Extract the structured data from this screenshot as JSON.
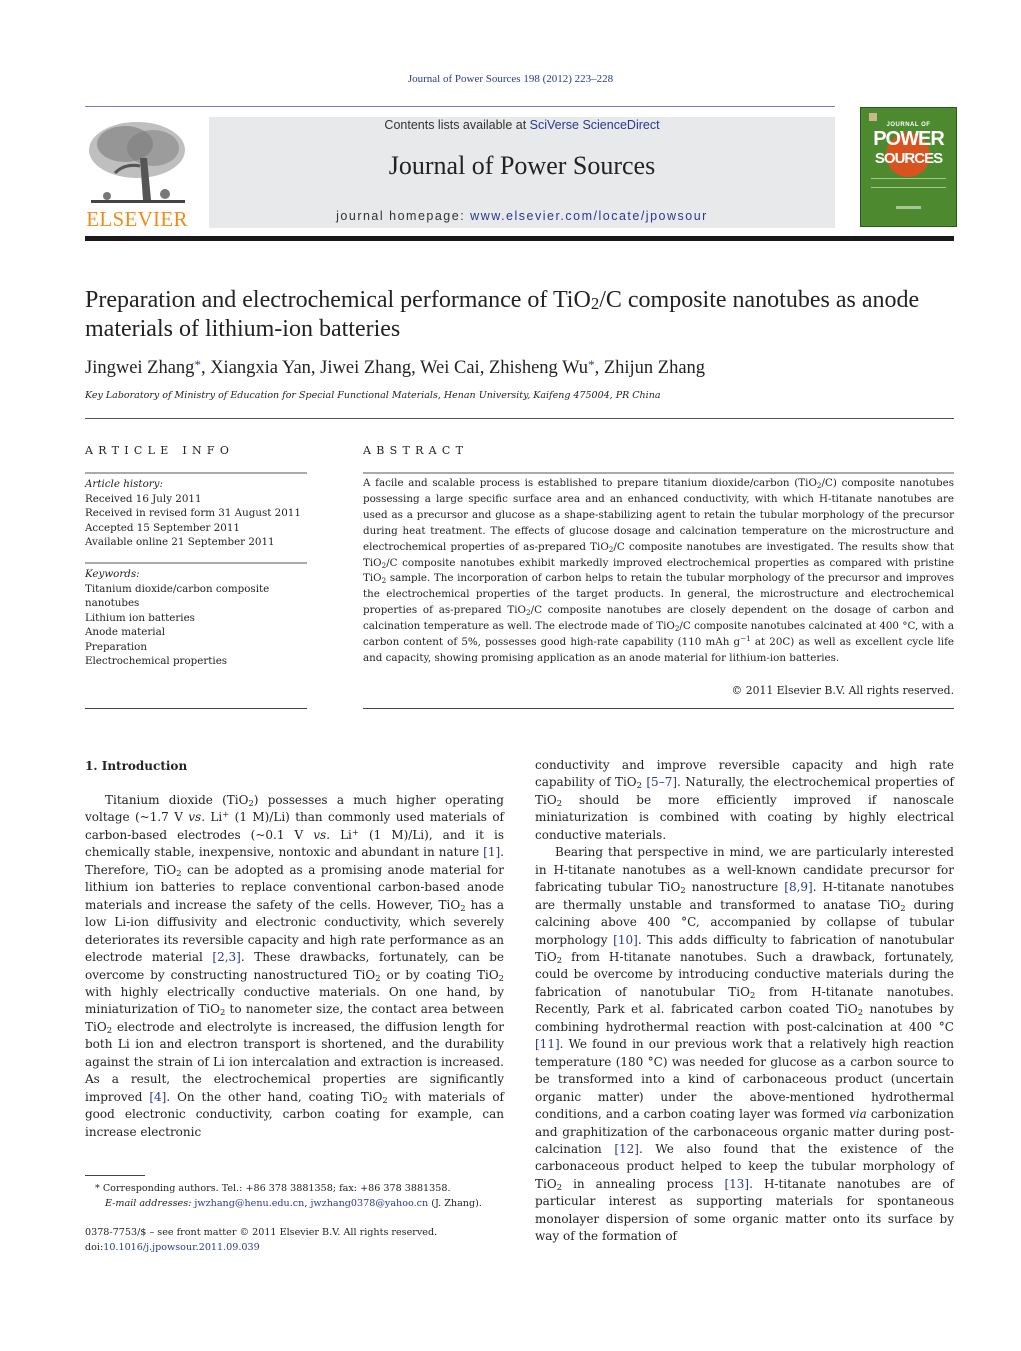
{
  "running_head": "Journal of Power Sources 198 (2012) 223–228",
  "masthead": {
    "publisher_logo_text": "ELSEVIER",
    "contents_prefix": "Contents lists available at ",
    "contents_link": "SciVerse ScienceDirect",
    "journal_name": "Journal of Power Sources",
    "homepage_prefix": "journal homepage: ",
    "homepage_link": "www.elsevier.com/locate/jpowsour",
    "cover": {
      "line1": "JOURNAL OF",
      "line2": "POWER",
      "line3": "SOURCES",
      "colors": {
        "background": "#4d8a2f",
        "circle": "#d9531e"
      }
    }
  },
  "article": {
    "title_part1": "Preparation and electrochemical performance of TiO",
    "title_sub": "2",
    "title_part2": "/C composite nanotubes as anode materials of lithium-ion batteries",
    "authors": [
      {
        "name": "Jingwei Zhang",
        "corresponding": true
      },
      {
        "name": "Xiangxia Yan",
        "corresponding": false
      },
      {
        "name": "Jiwei Zhang",
        "corresponding": false
      },
      {
        "name": "Wei Cai",
        "corresponding": false
      },
      {
        "name": "Zhisheng Wu",
        "corresponding": true
      },
      {
        "name": "Zhijun Zhang",
        "corresponding": false
      }
    ],
    "author_sep": ", ",
    "star": "*",
    "affiliation": "Key Laboratory of Ministry of Education for Special Functional Materials, Henan University, Kaifeng 475004, PR China"
  },
  "article_info": {
    "heading": "ARTICLE INFO",
    "history_label": "Article history:",
    "history": [
      "Received 16 July 2011",
      "Received in revised form 31 August 2011",
      "Accepted 15 September 2011",
      "Available online 21 September 2011"
    ],
    "keywords_label": "Keywords:",
    "keywords": [
      "Titanium dioxide/carbon composite nanotubes",
      "Lithium ion batteries",
      "Anode material",
      "Preparation",
      "Electrochemical properties"
    ]
  },
  "abstract": {
    "heading": "ABSTRACT",
    "segments": [
      "A facile and scalable process is established to prepare titanium dioxide/carbon (TiO",
      "2",
      "/C) composite nanotubes possessing a large specific surface area and an enhanced conductivity, with which H-titanate nanotubes are used as a precursor and glucose as a shape-stabilizing agent to retain the tubular morphology of the precursor during heat treatment. The effects of glucose dosage and calcination temperature on the microstructure and electrochemical properties of as-prepared TiO",
      "2",
      "/C composite nanotubes are investigated. The results show that TiO",
      "2",
      "/C composite nanotubes exhibit markedly improved electrochemical properties as compared with pristine TiO",
      "2",
      " sample. The incorporation of carbon helps to retain the tubular morphology of the precursor and improves the electrochemical properties of the target products. In general, the microstructure and electrochemical properties of as-prepared TiO",
      "2",
      "/C composite nanotubes are closely dependent on the dosage of carbon and calcination temperature as well. The electrode made of TiO",
      "2",
      "/C composite nanotubes calcinated at 400 °C, with a carbon content of 5%, possesses good high-rate capability (110 mAh g",
      "−1",
      " at 20C) as well as excellent cycle life and capacity, showing promising application as an anode material for lithium-ion batteries."
    ],
    "copyright": "© 2011 Elsevier B.V. All rights reserved."
  },
  "intro": {
    "heading": "1.  Introduction",
    "left": {
      "p1": [
        "Titanium dioxide (TiO",
        "2",
        ") possesses a much higher operating voltage (~1.7 V ",
        "vs.",
        " Li",
        "+",
        " (1 M)/Li) than commonly used materials of carbon-based electrodes (~0.1 V ",
        "vs.",
        " Li",
        "+",
        " (1 M)/Li), and it is chemically stable, inexpensive, nontoxic and abundant in nature ",
        "[1]",
        ". Therefore, TiO",
        "2",
        " can be adopted as a promising anode material for lithium ion batteries to replace conventional carbon-based anode materials and increase the safety of the cells. However, TiO",
        "2",
        " has a low Li-ion diffusivity and electronic conductivity, which severely deteriorates its reversible capacity and high rate performance as an electrode material ",
        "[2,3]",
        ". These drawbacks, fortunately, can be overcome by constructing nanostructured TiO",
        "2",
        " or by coating TiO",
        "2",
        " with highly electrically conductive materials. On one hand, by miniaturization of TiO",
        "2",
        " to nanometer size, the contact area between TiO",
        "2",
        " electrode and electrolyte is increased, the diffusion length for both Li ion and electron transport is shortened, and the durability against the strain of Li ion intercalation and extraction is increased. As a result, the electrochemical properties are significantly improved ",
        "[4]",
        ". On the other hand, coating TiO",
        "2",
        " with materials of good electronic conductivity, carbon coating for example, can increase electronic"
      ]
    },
    "right": {
      "p1": [
        "conductivity and improve reversible capacity and high rate capability of TiO",
        "2",
        " ",
        "[5–7]",
        ". Naturally, the electrochemical properties of TiO",
        "2",
        " should be more efficiently improved if nanoscale miniaturization is combined with coating by highly electrical conductive materials."
      ],
      "p2": [
        "Bearing that perspective in mind, we are particularly interested in H-titanate nanotubes as a well-known candidate precursor for fabricating tubular TiO",
        "2",
        " nanostructure ",
        "[8,9]",
        ". H-titanate nanotubes are thermally unstable and transformed to anatase TiO",
        "2",
        " during calcining above 400 °C, accompanied by collapse of tubular morphology ",
        "[10]",
        ". This adds difficulty to fabrication of nanotubular TiO",
        "2",
        " from H-titanate nanotubes. Such a drawback, fortunately, could be overcome by introducing conductive materials during the fabrication of nanotubular TiO",
        "2",
        " from H-titanate nanotubes. Recently, Park et al. fabricated carbon coated TiO",
        "2",
        " nanotubes by combining hydrothermal reaction with post-calcination at 400 °C ",
        "[11]",
        ". We found in our previous work that a relatively high reaction temperature (180 °C) was needed for glucose as a carbon source to be transformed into a kind of carbonaceous product (uncertain organic matter) under the above-mentioned hydrothermal conditions, and a carbon coating layer was formed ",
        "via",
        " carbonization and graphitization of the carbonaceous organic matter during post-calcination ",
        "[12]",
        ". We also found that the existence of the carbonaceous product helped to keep the tubular morphology of TiO",
        "2",
        " in annealing process ",
        "[13]",
        ". H-titanate nanotubes are of particular interest as supporting materials for spontaneous monolayer dispersion of some organic matter onto its surface by way of the formation of"
      ]
    }
  },
  "footnote": {
    "star": "*",
    "line1": " Corresponding authors. Tel.: +86 378 3881358; fax: +86 378 3881358.",
    "email_label": "E-mail addresses: ",
    "email1": "jwzhang@henu.edu.cn",
    "email_sep": ", ",
    "email2": "jwzhang0378@yahoo.cn",
    "email_suffix": " (J. Zhang)."
  },
  "issn": {
    "line1": "0378-7753/$ – see front matter © 2011 Elsevier B.V. All rights reserved.",
    "doi_prefix": "doi:",
    "doi": "10.1016/j.jpowsour.2011.09.039"
  }
}
